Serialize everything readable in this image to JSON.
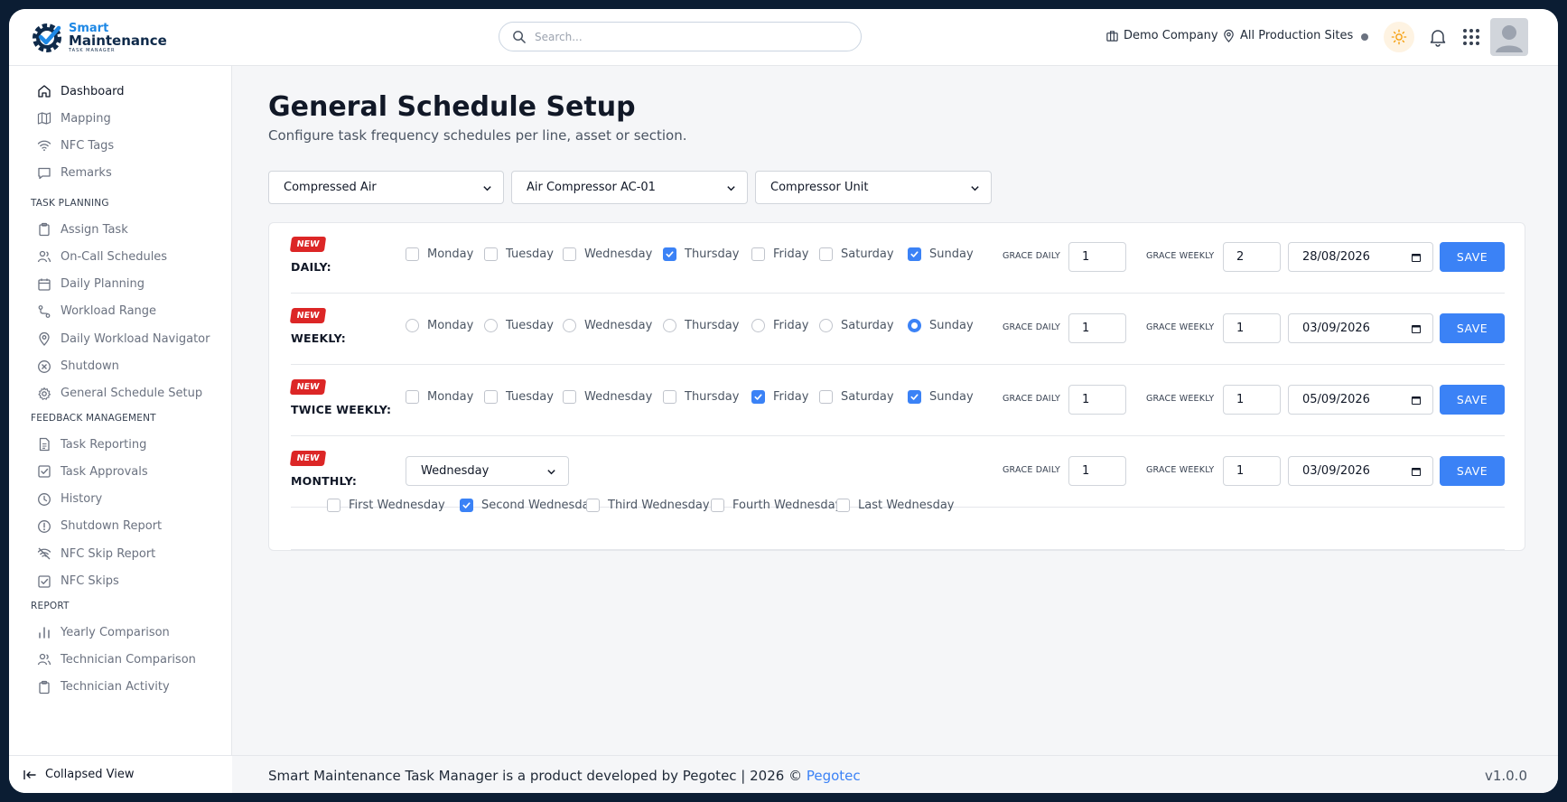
{
  "brand": {
    "line1": "Smart",
    "line2": "Maintenance",
    "line3": "TASK MANAGER",
    "accent": "#1e88e5"
  },
  "search": {
    "placeholder": "Search..."
  },
  "header": {
    "company": "Demo Company",
    "sites": "All Production Sites"
  },
  "sidebar": {
    "top": [
      {
        "label": "Dashboard",
        "icon": "home-icon"
      },
      {
        "label": "Mapping",
        "icon": "map-icon"
      },
      {
        "label": "NFC Tags",
        "icon": "wifi-icon"
      },
      {
        "label": "Remarks",
        "icon": "message-icon"
      }
    ],
    "sections": [
      {
        "title": "TASK PLANNING",
        "items": [
          {
            "label": "Assign Task",
            "icon": "clipboard-icon"
          },
          {
            "label": "On-Call Schedules",
            "icon": "users-icon"
          },
          {
            "label": "Daily Planning",
            "icon": "calendar-icon"
          },
          {
            "label": "Workload Range",
            "icon": "route-icon"
          },
          {
            "label": "Daily Workload Navigator",
            "icon": "pin-icon"
          },
          {
            "label": "Shutdown",
            "icon": "x-circle-icon"
          },
          {
            "label": "General Schedule Setup",
            "icon": "gear-icon"
          }
        ]
      },
      {
        "title": "FEEDBACK MANAGEMENT",
        "items": [
          {
            "label": "Task Reporting",
            "icon": "file-icon"
          },
          {
            "label": "Task Approvals",
            "icon": "check-square-icon"
          },
          {
            "label": "History",
            "icon": "clock-icon"
          },
          {
            "label": "Shutdown Report",
            "icon": "alert-circle-icon"
          },
          {
            "label": "NFC Skip Report",
            "icon": "wifi-off-icon"
          },
          {
            "label": "NFC Skips",
            "icon": "check-square-icon"
          }
        ]
      },
      {
        "title": "REPORT",
        "items": [
          {
            "label": "Yearly Comparison",
            "icon": "bar-chart-icon"
          },
          {
            "label": "Technician Comparison",
            "icon": "users-icon"
          },
          {
            "label": "Technician Activity",
            "icon": "clipboard-icon"
          }
        ]
      }
    ],
    "collapse_label": "Collapsed View"
  },
  "page": {
    "title": "General Schedule Setup",
    "subtitle": "Configure task frequency schedules per line, asset or section."
  },
  "filters": [
    "Compressed Air",
    "Air Compressor AC-01",
    "Compressor Unit"
  ],
  "schedule": {
    "badge": "NEW",
    "grace_daily_label": "GRACE DAILY",
    "grace_weekly_label": "GRACE WEEKLY",
    "save_label": "SAVE",
    "days": [
      "Monday",
      "Tuesday",
      "Wednesday",
      "Thursday",
      "Friday",
      "Saturday",
      "Sunday"
    ],
    "rows": [
      {
        "label": "DAILY:",
        "kind": "checkbox",
        "selected": [
          "Thursday",
          "Sunday"
        ],
        "grace_daily": "1",
        "grace_weekly": "2",
        "date": "28/08/2026"
      },
      {
        "label": "WEEKLY:",
        "kind": "radio",
        "selected": [
          "Sunday"
        ],
        "grace_daily": "1",
        "grace_weekly": "1",
        "date": "03/09/2026"
      },
      {
        "label": "TWICE WEEKLY:",
        "kind": "checkbox",
        "selected": [
          "Friday",
          "Sunday"
        ],
        "grace_daily": "1",
        "grace_weekly": "1",
        "date": "05/09/2026"
      },
      {
        "label": "MONTHLY:",
        "kind": "select",
        "select_value": "Wednesday",
        "grace_daily": "1",
        "grace_weekly": "1",
        "date": "03/09/2026",
        "occurrences": [
          {
            "label": "First Wednesday",
            "checked": false
          },
          {
            "label": "Second Wednesday",
            "checked": true
          },
          {
            "label": "Third Wednesday",
            "checked": false
          },
          {
            "label": "Fourth Wednesday",
            "checked": false
          },
          {
            "label": "Last Wednesday",
            "checked": false
          }
        ]
      }
    ]
  },
  "footer": {
    "text": "Smart Maintenance Task Manager is a product developed by Pegotec | 2026 © ",
    "link": "Pegotec",
    "version": "v1.0.0"
  },
  "colors": {
    "primary": "#3b82f6",
    "badge": "#dc2626",
    "frame": "#0b1d33"
  }
}
